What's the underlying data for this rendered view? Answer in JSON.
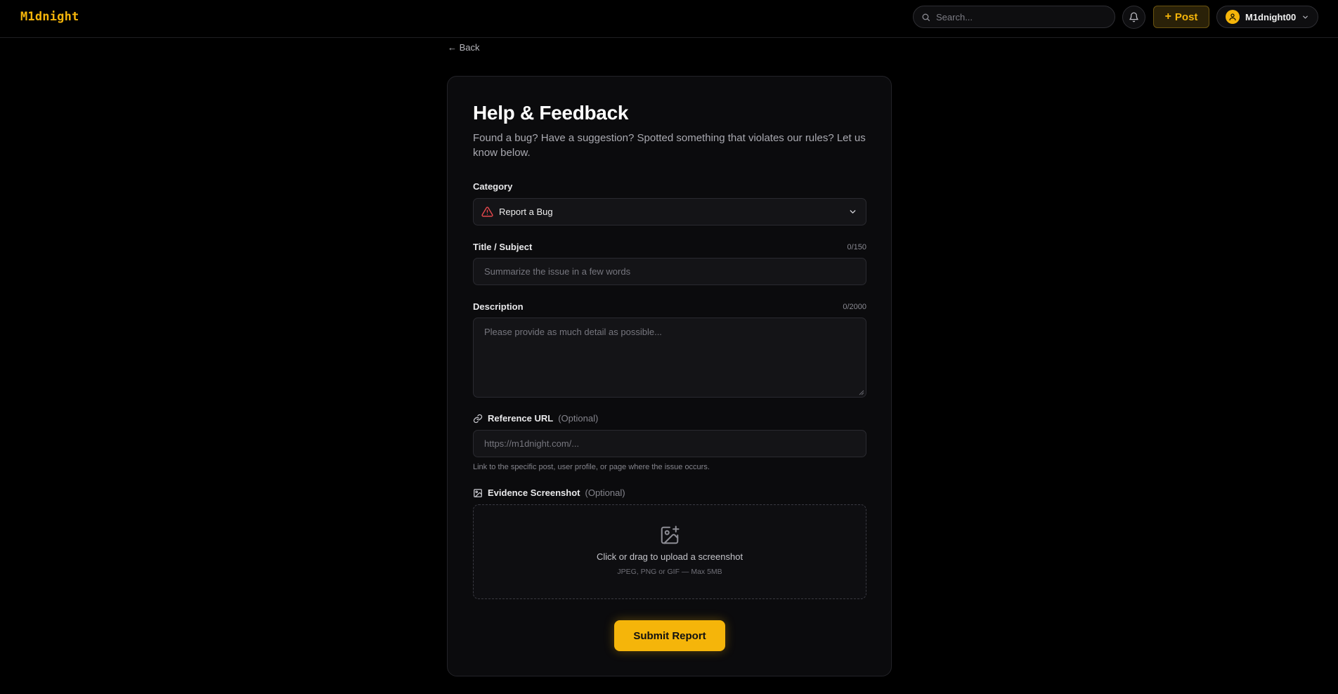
{
  "app": {
    "logo": "M1dnight"
  },
  "header": {
    "search_placeholder": "Search...",
    "post_label": "Post",
    "post_plus": "+",
    "username": "M1dnight00"
  },
  "nav": {
    "back_label": "← Back"
  },
  "form": {
    "title": "Help & Feedback",
    "subtitle": "Found a bug? Have a suggestion? Spotted something that violates our rules? Let us know below.",
    "category": {
      "label": "Category",
      "selected": "Report a Bug",
      "selected_icon": "warning-triangle-icon"
    },
    "title_field": {
      "label": "Title / Subject",
      "counter": "0/150",
      "placeholder": "Summarize the issue in a few words"
    },
    "description": {
      "label": "Description",
      "counter": "0/2000",
      "placeholder": "Please provide as much detail as possible..."
    },
    "reference_url": {
      "label": "Reference URL",
      "optional": "(Optional)",
      "placeholder": "https://m1dnight.com/...",
      "help": "Link to the specific post, user profile, or page where the issue occurs."
    },
    "screenshot": {
      "label": "Evidence Screenshot",
      "optional": "(Optional)",
      "upload_text": "Click or drag to upload a screenshot",
      "upload_hint": "JPEG, PNG or GIF — Max 5MB"
    },
    "submit_label": "Submit Report"
  },
  "colors": {
    "accent": "#f5b50a",
    "background": "#000000",
    "card": "#0b0b0d",
    "warning": "#e5484d"
  }
}
